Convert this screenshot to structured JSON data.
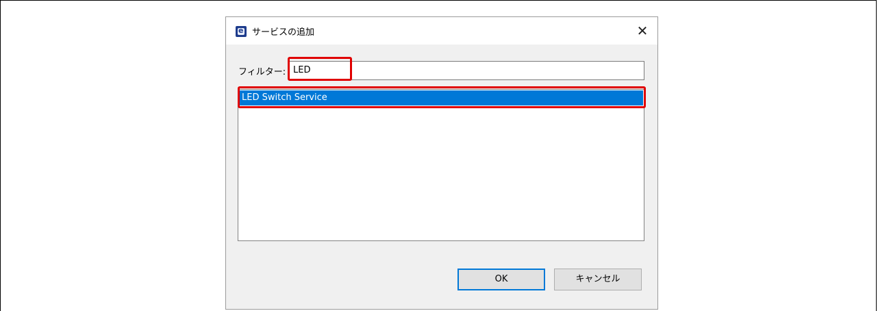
{
  "dialog": {
    "title": "サービスの追加",
    "app_icon": "e2-studio-icon",
    "close_glyph": "✕"
  },
  "filter": {
    "label": "フィルター:",
    "value": "LED"
  },
  "services": {
    "items": [
      {
        "label": "LED Switch Service",
        "selected": true
      }
    ]
  },
  "buttons": {
    "ok_label": "OK",
    "cancel_label": "キャンセル"
  },
  "colors": {
    "selection": "#0078d7",
    "highlight": "#e00000",
    "dialog_bg": "#f0f0f0"
  }
}
